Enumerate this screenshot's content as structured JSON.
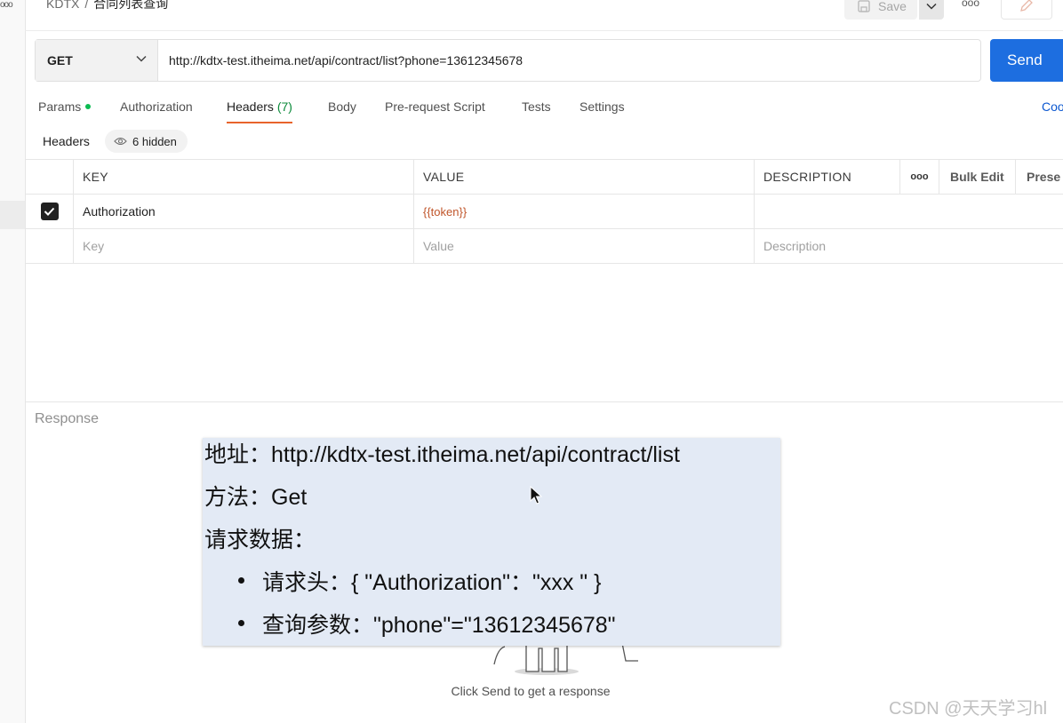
{
  "breadcrumb": {
    "workspace": "KDTX",
    "separator": "/",
    "request_name": "合同列表查询"
  },
  "toolbar": {
    "save_label": "Save",
    "more_icon": "more-horizontal-icon",
    "edit_icon": "pencil-icon"
  },
  "request": {
    "method": "GET",
    "url": "http://kdtx-test.itheima.net/api/contract/list?phone=13612345678",
    "send_label": "Send"
  },
  "tabs": [
    {
      "label": "Params"
    },
    {
      "label": "Authorization"
    },
    {
      "label": "Headers",
      "count": "(7)"
    },
    {
      "label": "Body"
    },
    {
      "label": "Pre-request Script"
    },
    {
      "label": "Tests"
    },
    {
      "label": "Settings"
    }
  ],
  "cookies_label": "Coo",
  "headers_section": {
    "title": "Headers",
    "hidden_label": "6 hidden",
    "columns": {
      "key": "KEY",
      "value": "VALUE",
      "description": "DESCRIPTION",
      "bulk_edit": "Bulk Edit",
      "presets": "Prese"
    },
    "rows": [
      {
        "key": "Authorization",
        "value": "{{token}}",
        "description": "",
        "checked": true
      }
    ],
    "placeholders": {
      "key": "Key",
      "value": "Value",
      "description": "Description"
    }
  },
  "response": {
    "label": "Response",
    "empty_hint": "Click Send to get a response"
  },
  "overlay_note": {
    "address_line": "地址：http://kdtx-test.itheima.net/api/contract/list",
    "method_line": "方法：Get",
    "data_line": "请求数据：",
    "bullets": [
      "请求头：{ \"Authorization\"：\"xxx \" }",
      "查询参数：\"phone\"=\"13612345678\""
    ]
  },
  "watermark": "CSDN @天天学习hl",
  "colors": {
    "send": "#1d6ee0",
    "active_tab_underline": "#e8642c",
    "params_dot": "#0cbb52",
    "token_var": "#c0552a"
  }
}
